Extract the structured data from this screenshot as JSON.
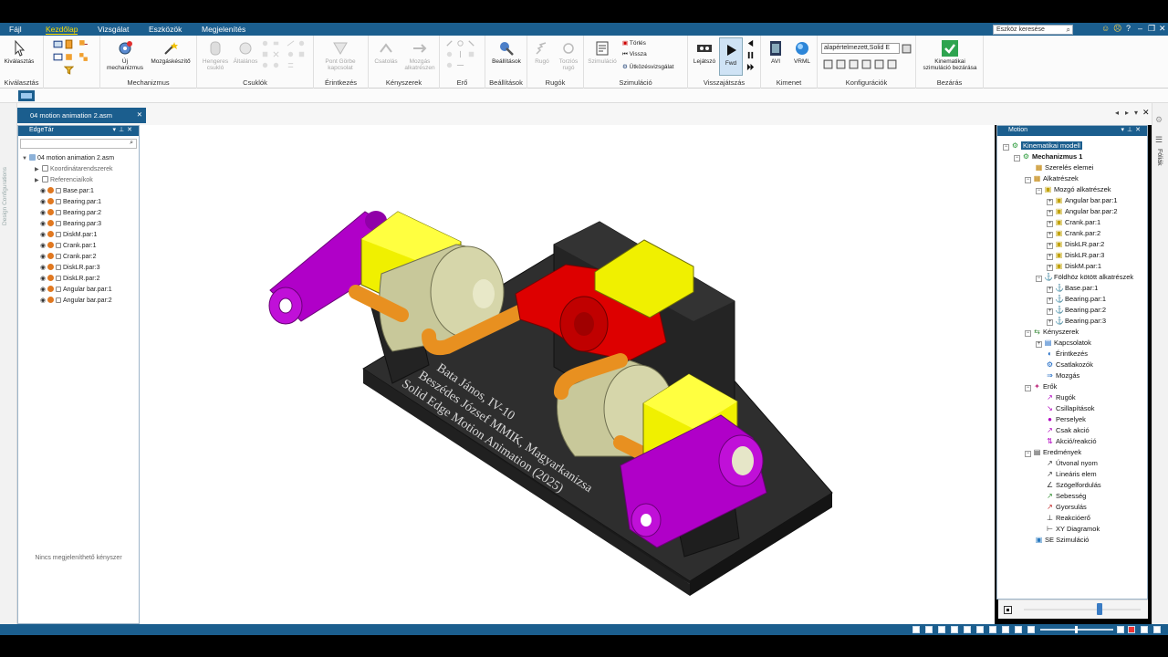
{
  "menu": {
    "items": [
      "Fájl",
      "Kezdőlap",
      "Vizsgálat",
      "Eszközök",
      "Megjelenítés"
    ],
    "active": "Kezdőlap",
    "search_placeholder": "Eszköz keresése"
  },
  "ribbon": {
    "kivalasztas": {
      "btn": "Kiválasztás",
      "group": "Kiválasztás"
    },
    "mechanizmus": {
      "btn1": "Új",
      "btn1b": "mechanizmus",
      "btn2": "Mozgáskészítő",
      "group": "Mechanizmus"
    },
    "csuklok": {
      "btn1": "Hengeres",
      "btn1b": "csukló",
      "btn2": "Általános",
      "group": "Csuklók"
    },
    "erintkezes": {
      "btn1": "Pont Görbe",
      "btn1b": "kapcsolat",
      "group": "Érintkezés"
    },
    "kenyszerek": {
      "btn1": "Csatolás",
      "btn2": "Mozgás",
      "btn2b": "alkatrészen",
      "group": "Kényszerek"
    },
    "ero": {
      "group": "Erő"
    },
    "beallitasok": {
      "btn": "Beállítások",
      "group": "Beállítások"
    },
    "rugok": {
      "btn1": "Rugó",
      "btn2": "Torziós",
      "btn2b": "rugó",
      "group": "Rugók"
    },
    "szimulacio": {
      "btn1": "Szimuláció",
      "s1": "Törlés",
      "s2": "Vissza",
      "s3": "Ütközésvizsgálat",
      "group": "Szimuláció"
    },
    "visszajatszas": {
      "btn1": "Lejátszó",
      "btn2": "Fwd",
      "group": "Visszajátszás"
    },
    "kimenet": {
      "btn1": "AVI",
      "btn2": "VRML",
      "group": "Kimenet"
    },
    "konfiguraciok": {
      "dropdown": "alapértelmezett,Solid E",
      "group": "Konfigurációk"
    },
    "bezaras": {
      "btn1": "Kinematikai",
      "btn1b": "szimuláció bezárása",
      "group": "Bezárás"
    }
  },
  "document_tab": "04 motion animation 2.asm",
  "left_rail_text": "Design Configurations",
  "edgebar": {
    "title": "EdgeTár",
    "root": "04 motion animation 2.asm",
    "items": [
      "Koordinátarendszerek",
      "Referenciaíkok"
    ],
    "parts": [
      {
        "name": "Base.par:1",
        "color": "#e07820"
      },
      {
        "name": "Bearing.par:1",
        "color": "#e07820"
      },
      {
        "name": "Bearing.par:2",
        "color": "#e07820"
      },
      {
        "name": "Bearing.par:3",
        "color": "#e07820"
      },
      {
        "name": "DiskM.par:1",
        "color": "#e07820"
      },
      {
        "name": "Crank.par:1",
        "color": "#e07820"
      },
      {
        "name": "Crank.par:2",
        "color": "#e07820"
      },
      {
        "name": "DiskLR.par:3",
        "color": "#e07820"
      },
      {
        "name": "DiskLR.par:2",
        "color": "#e07820"
      },
      {
        "name": "Angular bar.par:1",
        "color": "#e07820"
      },
      {
        "name": "Angular bar.par:2",
        "color": "#e07820"
      }
    ],
    "empty_message": "Nincs megjeleníthető kényszer"
  },
  "viewport": {
    "engraving": [
      "Bata János, IV-10",
      "Beszédes József MMIK, Magyarkanizsa",
      "Solid Edge Motion Animation (2025)"
    ]
  },
  "motion": {
    "title": "Motion",
    "rail_label": "Fóliák",
    "tree": [
      {
        "label": "Kinematikai modell",
        "depth": 0,
        "icon": "model",
        "selected": true
      },
      {
        "label": "Mechanizmus 1",
        "depth": 1,
        "icon": "mech",
        "bold": true
      },
      {
        "label": "Szerelés elemei",
        "depth": 2,
        "icon": "asm"
      },
      {
        "label": "Alkatrészek",
        "depth": 2,
        "icon": "parts"
      },
      {
        "label": "Mozgó alkatrészek",
        "depth": 3,
        "icon": "moving"
      },
      {
        "label": "Angular bar.par:1",
        "depth": 4,
        "icon": "part"
      },
      {
        "label": "Angular bar.par:2",
        "depth": 4,
        "icon": "part"
      },
      {
        "label": "Crank.par:1",
        "depth": 4,
        "icon": "part"
      },
      {
        "label": "Crank.par:2",
        "depth": 4,
        "icon": "part"
      },
      {
        "label": "DiskLR.par:2",
        "depth": 4,
        "icon": "part"
      },
      {
        "label": "DiskLR.par:3",
        "depth": 4,
        "icon": "part"
      },
      {
        "label": "DiskM.par:1",
        "depth": 4,
        "icon": "part"
      },
      {
        "label": "Földhöz kötött alkatrészek",
        "depth": 3,
        "icon": "ground"
      },
      {
        "label": "Base.par:1",
        "depth": 4,
        "icon": "gpart"
      },
      {
        "label": "Bearing.par:1",
        "depth": 4,
        "icon": "gpart"
      },
      {
        "label": "Bearing.par:2",
        "depth": 4,
        "icon": "gpart"
      },
      {
        "label": "Bearing.par:3",
        "depth": 4,
        "icon": "gpart"
      },
      {
        "label": "Kényszerek",
        "depth": 2,
        "icon": "constraints"
      },
      {
        "label": "Kapcsolatok",
        "depth": 3,
        "icon": "joint"
      },
      {
        "label": "Érintkezés",
        "depth": 3,
        "icon": "contact"
      },
      {
        "label": "Csatlakozók",
        "depth": 3,
        "icon": "coupler"
      },
      {
        "label": "Mozgás",
        "depth": 3,
        "icon": "motion"
      },
      {
        "label": "Erők",
        "depth": 2,
        "icon": "forces"
      },
      {
        "label": "Rugók",
        "depth": 3,
        "icon": "spring"
      },
      {
        "label": "Csillapítások",
        "depth": 3,
        "icon": "damper"
      },
      {
        "label": "Perselyek",
        "depth": 3,
        "icon": "bushing"
      },
      {
        "label": "Csak akció",
        "depth": 3,
        "icon": "action"
      },
      {
        "label": "Akció/reakció",
        "depth": 3,
        "icon": "actreact"
      },
      {
        "label": "Eredmények",
        "depth": 2,
        "icon": "results"
      },
      {
        "label": "Útvonal nyom",
        "depth": 3,
        "icon": "trace"
      },
      {
        "label": "Lineáris elem",
        "depth": 3,
        "icon": "linear"
      },
      {
        "label": "Szögelfordulás",
        "depth": 3,
        "icon": "angular"
      },
      {
        "label": "Sebesség",
        "depth": 3,
        "icon": "velocity"
      },
      {
        "label": "Gyorsulás",
        "depth": 3,
        "icon": "accel"
      },
      {
        "label": "Reakcióerő",
        "depth": 3,
        "icon": "reaction"
      },
      {
        "label": "XY Diagramok",
        "depth": 3,
        "icon": "xy"
      },
      {
        "label": "SE Szimuláció",
        "depth": 2,
        "icon": "sim"
      }
    ]
  },
  "colors": {
    "accent": "#1b5e8e",
    "yellow": "#f0f000",
    "red": "#dd0000",
    "magenta": "#b000c8",
    "orange": "#e89020",
    "khaki": "#c8c89a",
    "base": "#2a2a2a"
  }
}
